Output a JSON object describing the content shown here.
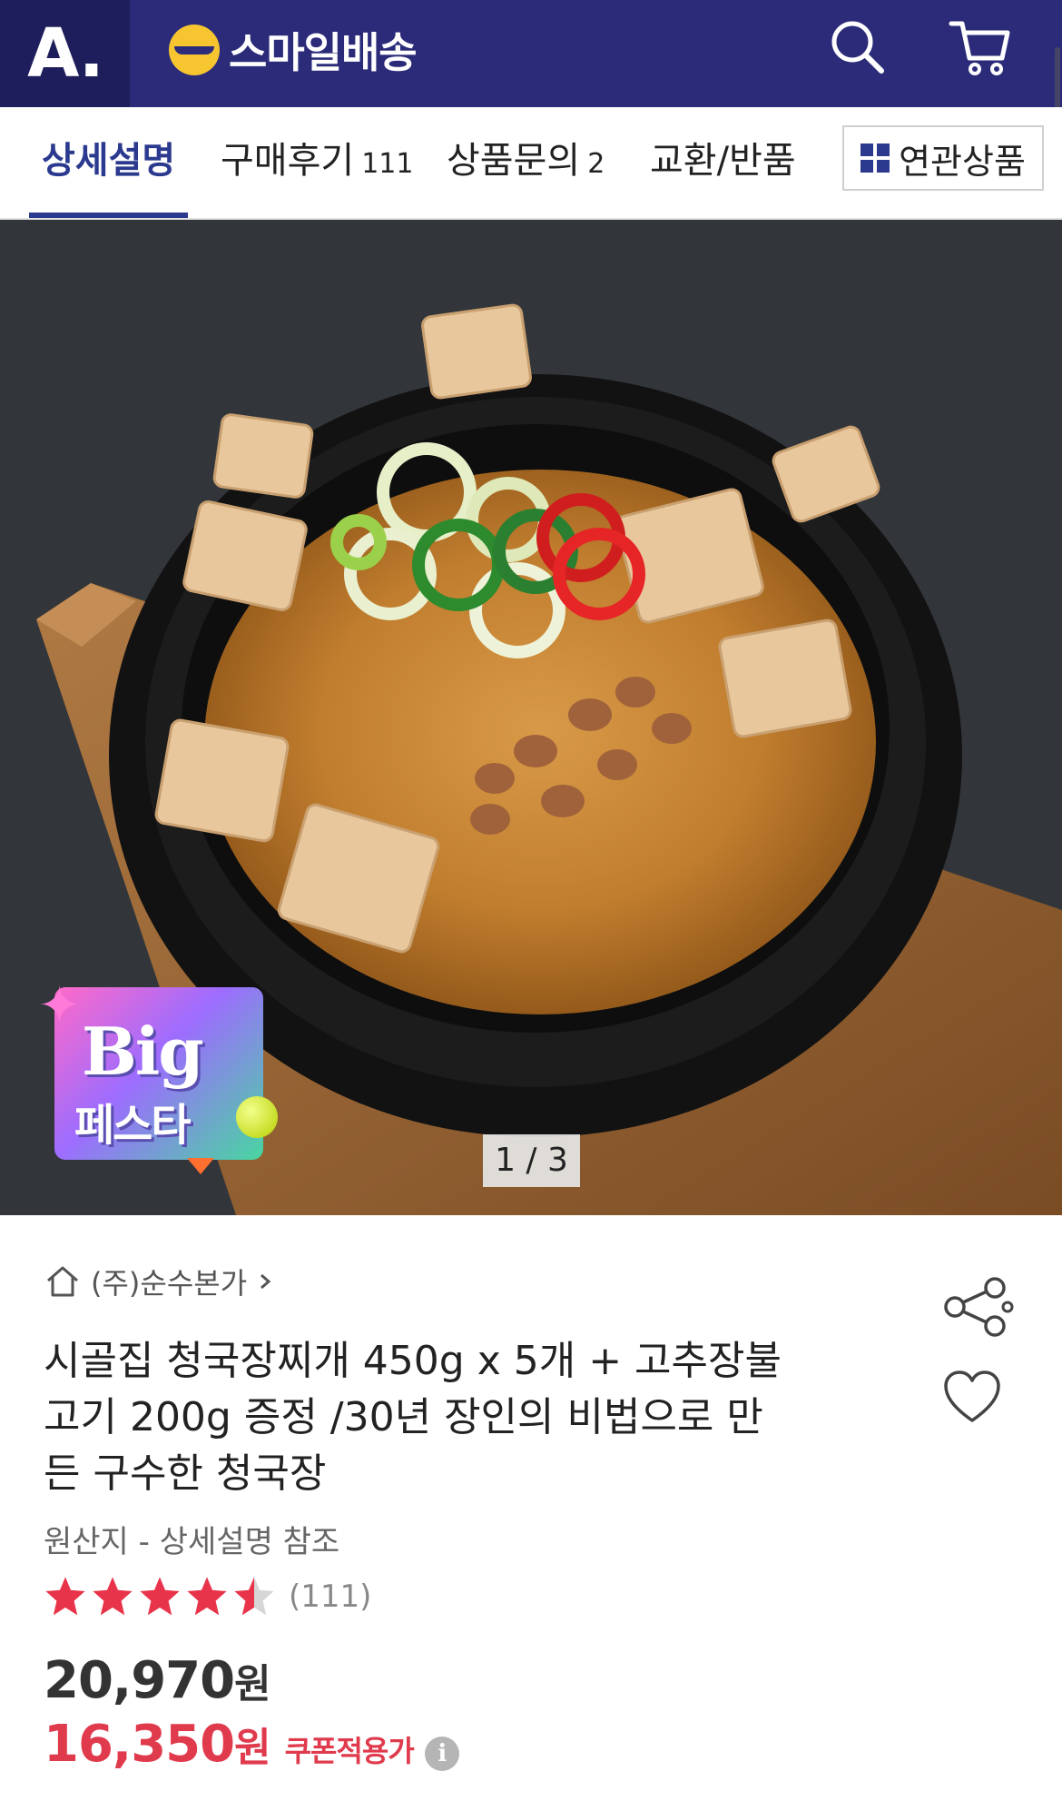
{
  "header": {
    "logo": "A.",
    "brand": "스마일배송",
    "icons": [
      "search-icon",
      "cart-icon"
    ]
  },
  "tabs": [
    {
      "label": "상세설명",
      "count": ""
    },
    {
      "label": "구매후기",
      "count": "111"
    },
    {
      "label": "상품문의",
      "count": "2"
    },
    {
      "label": "교환/반품",
      "count": ""
    }
  ],
  "related_button": "연관상품",
  "gallery": {
    "badge_line1": "Big",
    "badge_line2": "페스타",
    "pager": "1 / 3"
  },
  "product": {
    "store": "(주)순수본가",
    "title": "시골집 청국장찌개 450g x 5개 + 고추장불고기 200g 증정 /30년 장인의 비법으로 만든 구수한 청국장",
    "origin": "원산지 - 상세설명 참조",
    "rating": 4.5,
    "review_count": "(111)",
    "original_price": "20,970",
    "sale_price": "16,350",
    "currency": "원",
    "coupon_label": "쿠폰적용가",
    "info_glyph": "i"
  },
  "colors": {
    "header_bg": "#2b2b7a",
    "accent_blue": "#2b3a8f",
    "sale_red": "#e03a4d",
    "star_red": "#e8344a"
  }
}
